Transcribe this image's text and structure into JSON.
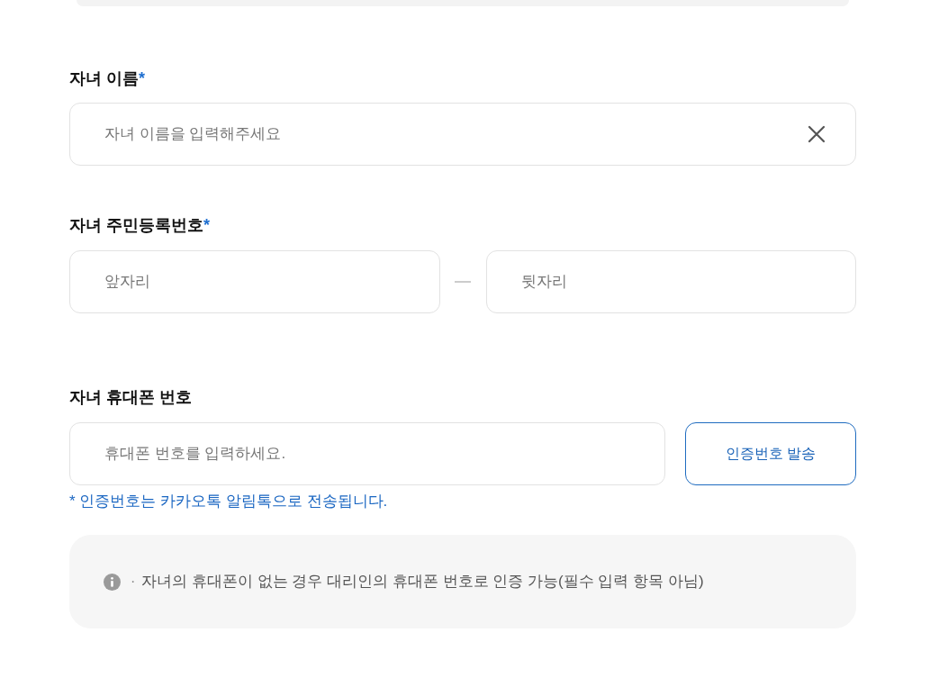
{
  "fields": [
    {
      "kind": "text",
      "label": "자녀 이름",
      "required_mark": "*",
      "placeholder": "자녀 이름을 입력해주세요",
      "clear_button": true
    },
    {
      "kind": "split",
      "label": "자녀 주민등록번호",
      "required_mark": "*",
      "parts": [
        {
          "placeholder": "앞자리"
        },
        {
          "placeholder": "뒷자리"
        }
      ]
    },
    {
      "kind": "phone",
      "label": "자녀 휴대폰 번호",
      "placeholder": "휴대폰 번호를 입력하세요.",
      "button": "인증번호 발송",
      "note": "* 인증번호는 카카오톡 알림톡으로 전송됩니다."
    }
  ],
  "info": {
    "bullet": "·",
    "text": "자녀의 휴대폰이 없는 경우 대리인의 휴대폰 번호로 인증 가능(필수 입력 항목 아님)"
  }
}
